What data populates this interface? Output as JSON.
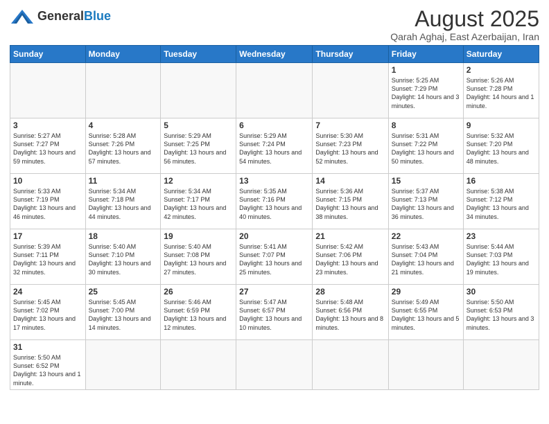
{
  "header": {
    "logo_general": "General",
    "logo_blue": "Blue",
    "month_title": "August 2025",
    "location": "Qarah Aghaj, East Azerbaijan, Iran"
  },
  "weekdays": [
    "Sunday",
    "Monday",
    "Tuesday",
    "Wednesday",
    "Thursday",
    "Friday",
    "Saturday"
  ],
  "weeks": [
    [
      {
        "day": "",
        "info": ""
      },
      {
        "day": "",
        "info": ""
      },
      {
        "day": "",
        "info": ""
      },
      {
        "day": "",
        "info": ""
      },
      {
        "day": "",
        "info": ""
      },
      {
        "day": "1",
        "info": "Sunrise: 5:25 AM\nSunset: 7:29 PM\nDaylight: 14 hours\nand 3 minutes."
      },
      {
        "day": "2",
        "info": "Sunrise: 5:26 AM\nSunset: 7:28 PM\nDaylight: 14 hours\nand 1 minute."
      }
    ],
    [
      {
        "day": "3",
        "info": "Sunrise: 5:27 AM\nSunset: 7:27 PM\nDaylight: 13 hours\nand 59 minutes."
      },
      {
        "day": "4",
        "info": "Sunrise: 5:28 AM\nSunset: 7:26 PM\nDaylight: 13 hours\nand 57 minutes."
      },
      {
        "day": "5",
        "info": "Sunrise: 5:29 AM\nSunset: 7:25 PM\nDaylight: 13 hours\nand 56 minutes."
      },
      {
        "day": "6",
        "info": "Sunrise: 5:29 AM\nSunset: 7:24 PM\nDaylight: 13 hours\nand 54 minutes."
      },
      {
        "day": "7",
        "info": "Sunrise: 5:30 AM\nSunset: 7:23 PM\nDaylight: 13 hours\nand 52 minutes."
      },
      {
        "day": "8",
        "info": "Sunrise: 5:31 AM\nSunset: 7:22 PM\nDaylight: 13 hours\nand 50 minutes."
      },
      {
        "day": "9",
        "info": "Sunrise: 5:32 AM\nSunset: 7:20 PM\nDaylight: 13 hours\nand 48 minutes."
      }
    ],
    [
      {
        "day": "10",
        "info": "Sunrise: 5:33 AM\nSunset: 7:19 PM\nDaylight: 13 hours\nand 46 minutes."
      },
      {
        "day": "11",
        "info": "Sunrise: 5:34 AM\nSunset: 7:18 PM\nDaylight: 13 hours\nand 44 minutes."
      },
      {
        "day": "12",
        "info": "Sunrise: 5:34 AM\nSunset: 7:17 PM\nDaylight: 13 hours\nand 42 minutes."
      },
      {
        "day": "13",
        "info": "Sunrise: 5:35 AM\nSunset: 7:16 PM\nDaylight: 13 hours\nand 40 minutes."
      },
      {
        "day": "14",
        "info": "Sunrise: 5:36 AM\nSunset: 7:15 PM\nDaylight: 13 hours\nand 38 minutes."
      },
      {
        "day": "15",
        "info": "Sunrise: 5:37 AM\nSunset: 7:13 PM\nDaylight: 13 hours\nand 36 minutes."
      },
      {
        "day": "16",
        "info": "Sunrise: 5:38 AM\nSunset: 7:12 PM\nDaylight: 13 hours\nand 34 minutes."
      }
    ],
    [
      {
        "day": "17",
        "info": "Sunrise: 5:39 AM\nSunset: 7:11 PM\nDaylight: 13 hours\nand 32 minutes."
      },
      {
        "day": "18",
        "info": "Sunrise: 5:40 AM\nSunset: 7:10 PM\nDaylight: 13 hours\nand 30 minutes."
      },
      {
        "day": "19",
        "info": "Sunrise: 5:40 AM\nSunset: 7:08 PM\nDaylight: 13 hours\nand 27 minutes."
      },
      {
        "day": "20",
        "info": "Sunrise: 5:41 AM\nSunset: 7:07 PM\nDaylight: 13 hours\nand 25 minutes."
      },
      {
        "day": "21",
        "info": "Sunrise: 5:42 AM\nSunset: 7:06 PM\nDaylight: 13 hours\nand 23 minutes."
      },
      {
        "day": "22",
        "info": "Sunrise: 5:43 AM\nSunset: 7:04 PM\nDaylight: 13 hours\nand 21 minutes."
      },
      {
        "day": "23",
        "info": "Sunrise: 5:44 AM\nSunset: 7:03 PM\nDaylight: 13 hours\nand 19 minutes."
      }
    ],
    [
      {
        "day": "24",
        "info": "Sunrise: 5:45 AM\nSunset: 7:02 PM\nDaylight: 13 hours\nand 17 minutes."
      },
      {
        "day": "25",
        "info": "Sunrise: 5:45 AM\nSunset: 7:00 PM\nDaylight: 13 hours\nand 14 minutes."
      },
      {
        "day": "26",
        "info": "Sunrise: 5:46 AM\nSunset: 6:59 PM\nDaylight: 13 hours\nand 12 minutes."
      },
      {
        "day": "27",
        "info": "Sunrise: 5:47 AM\nSunset: 6:57 PM\nDaylight: 13 hours\nand 10 minutes."
      },
      {
        "day": "28",
        "info": "Sunrise: 5:48 AM\nSunset: 6:56 PM\nDaylight: 13 hours\nand 8 minutes."
      },
      {
        "day": "29",
        "info": "Sunrise: 5:49 AM\nSunset: 6:55 PM\nDaylight: 13 hours\nand 5 minutes."
      },
      {
        "day": "30",
        "info": "Sunrise: 5:50 AM\nSunset: 6:53 PM\nDaylight: 13 hours\nand 3 minutes."
      }
    ],
    [
      {
        "day": "31",
        "info": "Sunrise: 5:50 AM\nSunset: 6:52 PM\nDaylight: 13 hours\nand 1 minute."
      },
      {
        "day": "",
        "info": ""
      },
      {
        "day": "",
        "info": ""
      },
      {
        "day": "",
        "info": ""
      },
      {
        "day": "",
        "info": ""
      },
      {
        "day": "",
        "info": ""
      },
      {
        "day": "",
        "info": ""
      }
    ]
  ]
}
